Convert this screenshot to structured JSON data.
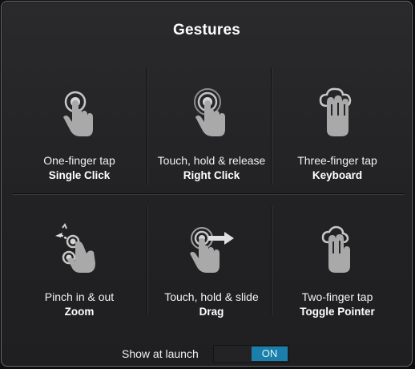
{
  "dialog": {
    "title": "Gestures",
    "gestures": [
      {
        "action": "One-finger tap",
        "result": "Single Click",
        "icon": "one-finger-tap-icon"
      },
      {
        "action": "Touch, hold & release",
        "result": "Right Click",
        "icon": "touch-hold-release-icon"
      },
      {
        "action": "Three-finger tap",
        "result": "Keyboard",
        "icon": "three-finger-tap-icon"
      },
      {
        "action": "Pinch in & out",
        "result": "Zoom",
        "icon": "pinch-icon"
      },
      {
        "action": "Touch, hold & slide",
        "result": "Drag",
        "icon": "touch-hold-slide-icon"
      },
      {
        "action": "Two-finger tap",
        "result": "Toggle Pointer",
        "icon": "two-finger-tap-icon"
      }
    ],
    "show_at_launch": {
      "label": "Show at launch",
      "state_label": "ON",
      "enabled": true
    }
  },
  "colors": {
    "toggle_on": "#1b7fab",
    "icon_gray": "#bdbdbd"
  }
}
